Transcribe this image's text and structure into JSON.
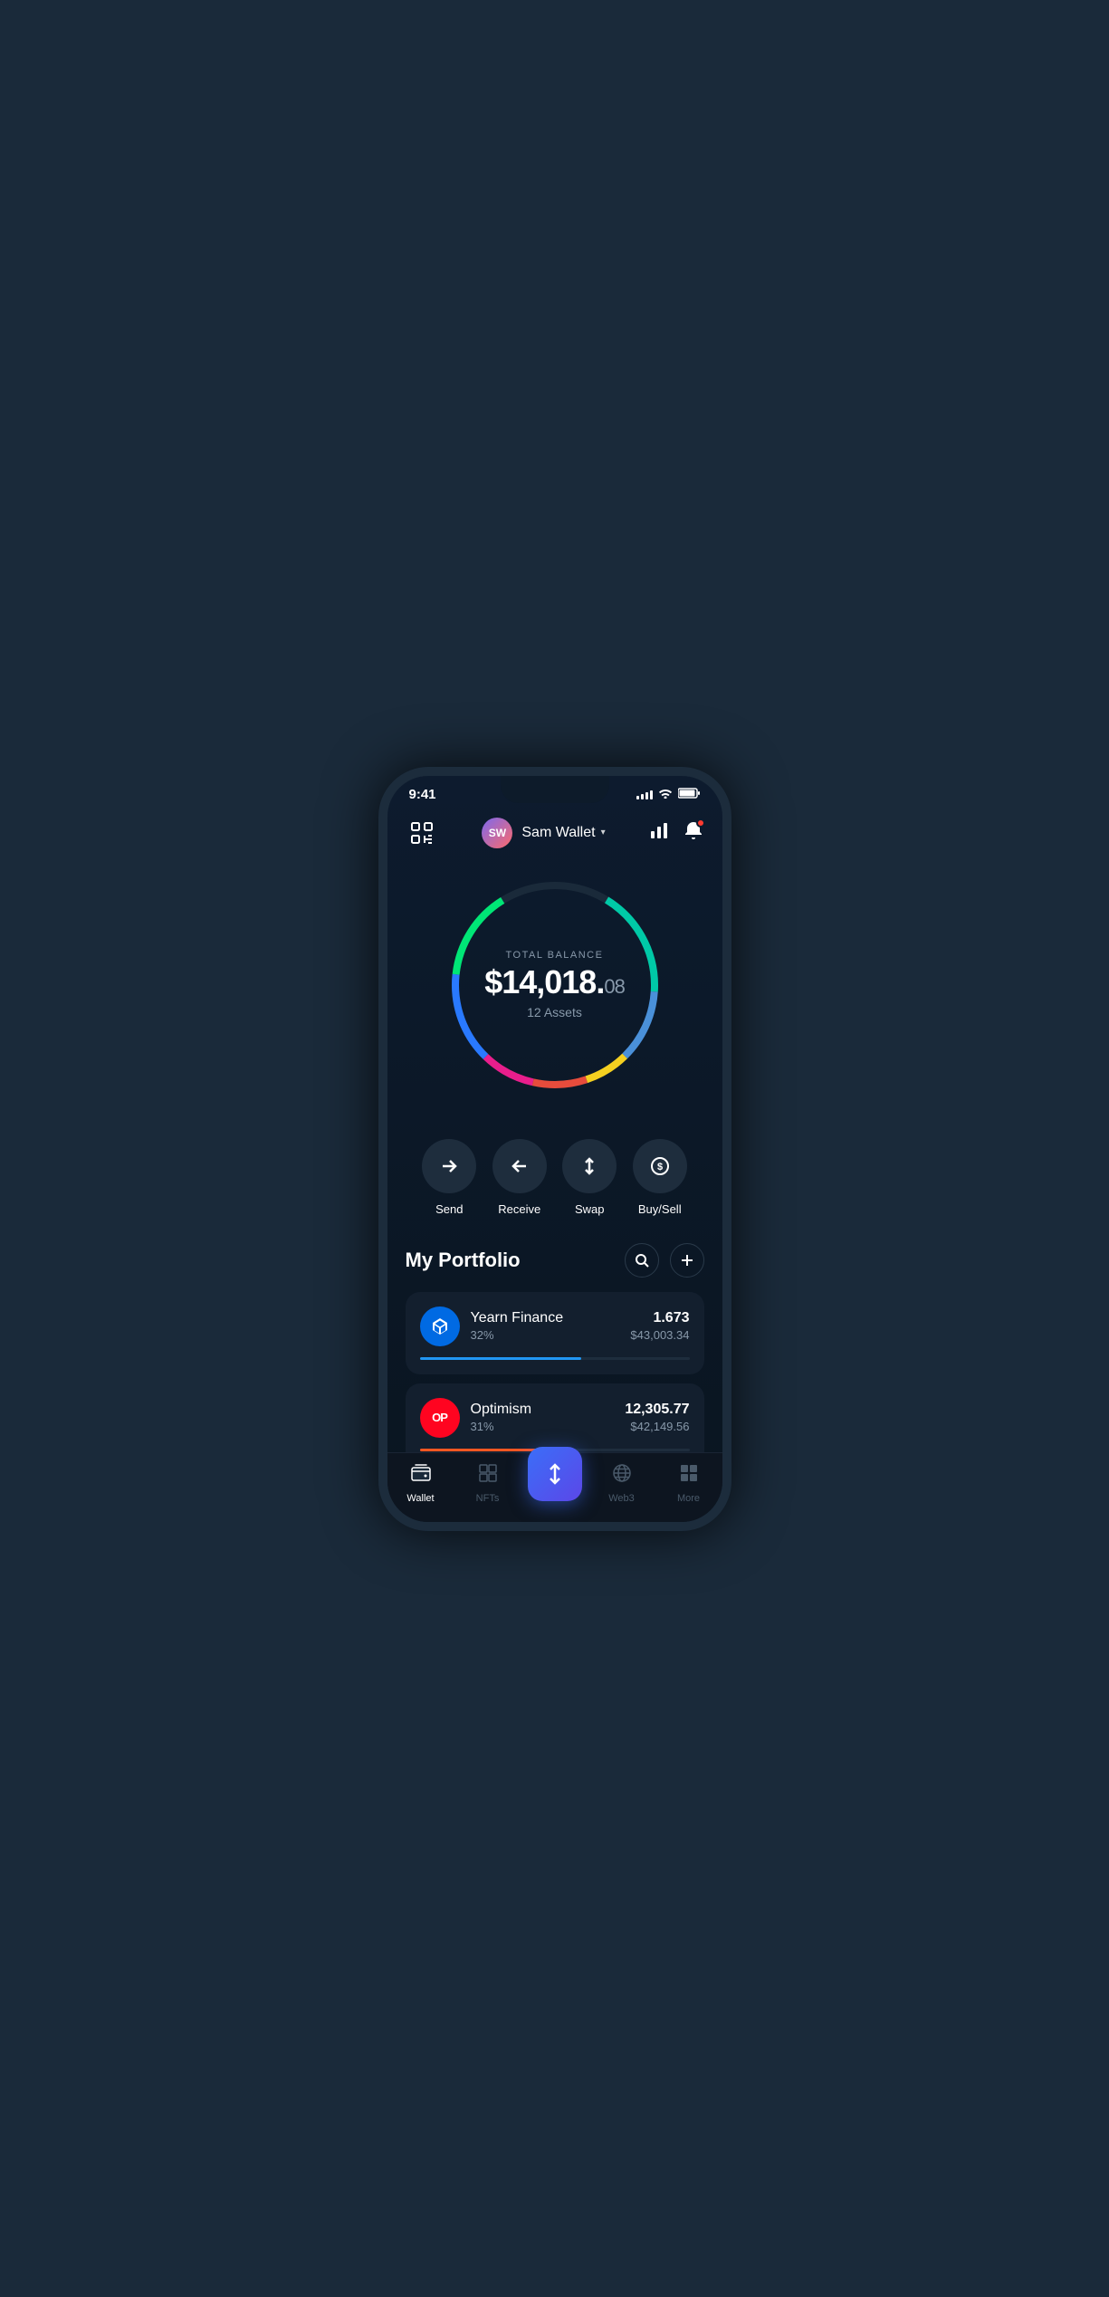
{
  "statusBar": {
    "time": "9:41"
  },
  "header": {
    "avatarInitials": "SW",
    "walletName": "Sam Wallet",
    "scanIconLabel": "scan-icon",
    "chartIconLabel": "chart-icon",
    "notifIconLabel": "notification-icon"
  },
  "balance": {
    "label": "TOTAL BALANCE",
    "whole": "$14,018.",
    "cents": "08",
    "assets": "12 Assets"
  },
  "actions": [
    {
      "id": "send",
      "label": "Send",
      "icon": "→"
    },
    {
      "id": "receive",
      "label": "Receive",
      "icon": "←"
    },
    {
      "id": "swap",
      "label": "Swap",
      "icon": "⇅"
    },
    {
      "id": "buysell",
      "label": "Buy/Sell",
      "icon": "$"
    }
  ],
  "portfolio": {
    "title": "My Portfolio",
    "searchLabel": "search-icon",
    "addLabel": "add-icon",
    "items": [
      {
        "id": "yearn",
        "name": "Yearn Finance",
        "percent": "32%",
        "amount": "1.673",
        "value": "$43,003.34",
        "barWidth": "60"
      },
      {
        "id": "optimism",
        "name": "Optimism",
        "percent": "31%",
        "amount": "12,305.77",
        "value": "$42,149.56",
        "barWidth": "55"
      }
    ]
  },
  "bottomNav": {
    "items": [
      {
        "id": "wallet",
        "label": "Wallet",
        "active": true
      },
      {
        "id": "nfts",
        "label": "NFTs",
        "active": false
      },
      {
        "id": "center",
        "label": "",
        "active": false
      },
      {
        "id": "web3",
        "label": "Web3",
        "active": false
      },
      {
        "id": "more",
        "label": "More",
        "active": false
      }
    ]
  },
  "colors": {
    "background": "#0d1b2e",
    "card": "#131f2e",
    "accent": "#3b6ef8",
    "text": "#ffffff",
    "subtext": "#8899aa"
  }
}
